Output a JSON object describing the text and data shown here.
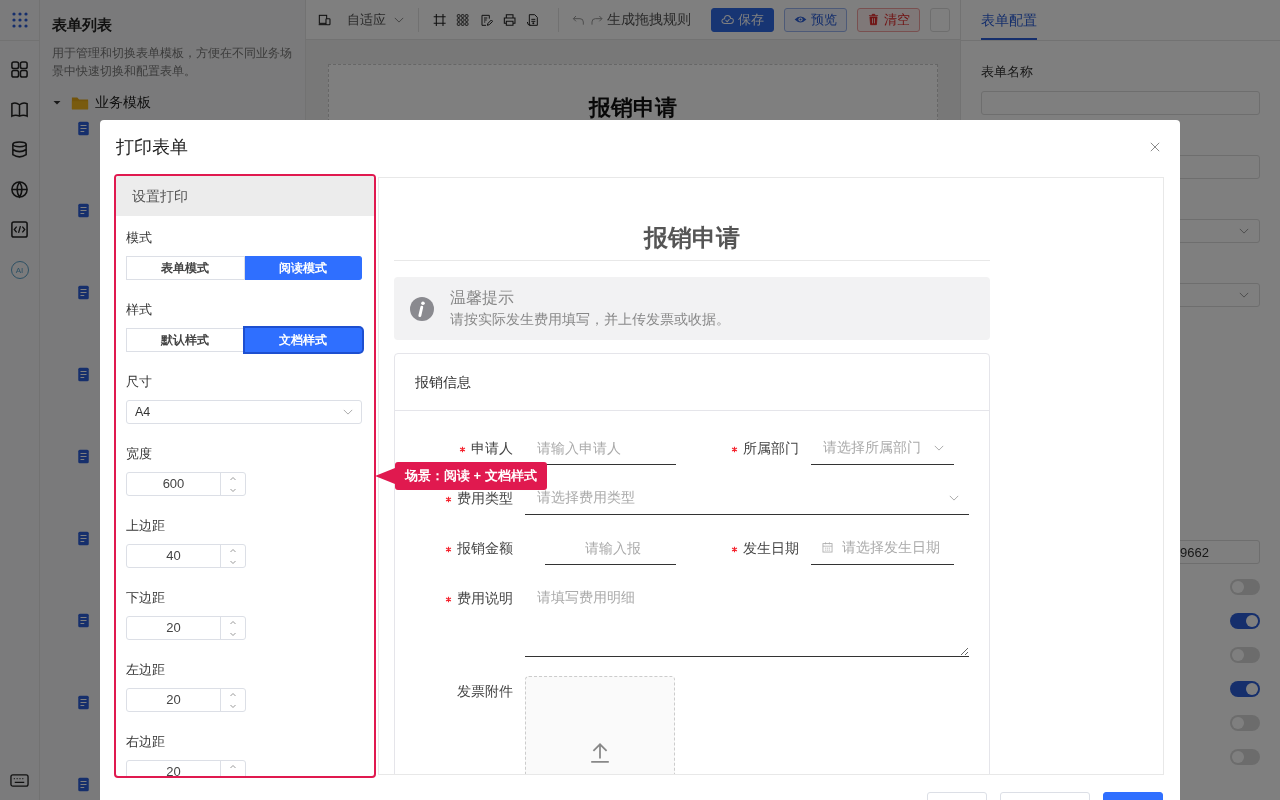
{
  "rail": {
    "items": [
      {
        "kind": "apps"
      },
      {
        "kind": "grid"
      },
      {
        "kind": "book"
      },
      {
        "kind": "database"
      },
      {
        "kind": "globe"
      },
      {
        "kind": "code"
      },
      {
        "kind": "ai",
        "label": "AI"
      }
    ],
    "bottom": {
      "kind": "keyboard"
    }
  },
  "sidebar": {
    "title": "表单列表",
    "description": "用于管理和切换表单模板，方便在不同业务场景中快速切换和配置表单。",
    "tree": [
      {
        "label": "业务模板",
        "expanded": true,
        "children": [
          {
            "kind": "doc"
          },
          {
            "kind": "doc"
          },
          {
            "kind": "doc"
          },
          {
            "kind": "doc"
          },
          {
            "kind": "doc"
          },
          {
            "kind": "doc"
          },
          {
            "kind": "doc"
          },
          {
            "kind": "doc"
          },
          {
            "kind": "doc"
          }
        ]
      }
    ]
  },
  "toolbar": {
    "device_select": "自适应",
    "tools": [
      {
        "kind": "device"
      },
      {
        "kind": "frame"
      },
      {
        "kind": "grid"
      },
      {
        "kind": "edit"
      },
      {
        "kind": "print"
      },
      {
        "kind": "scan"
      }
    ],
    "history": [
      {
        "kind": "undo"
      },
      {
        "kind": "redo"
      }
    ],
    "action": "生成拖拽规则",
    "buttons": [
      {
        "kind": "primary",
        "label": "保存"
      },
      {
        "kind": "outline",
        "label": "预览"
      },
      {
        "kind": "danger",
        "label": "清空"
      },
      {
        "kind": "plain"
      }
    ]
  },
  "canvas": {
    "title": "报销申请"
  },
  "right_panel": {
    "tabs": [
      {
        "label": "表单配置",
        "selected": true
      }
    ],
    "form_name_label": "表单名称",
    "fields": [
      {
        "kind": "input"
      },
      {
        "kind": "input"
      },
      {
        "kind": "select"
      },
      {
        "kind": "select"
      }
    ],
    "tail_input": {
      "value": "9662"
    },
    "switches": [
      {
        "on": false
      },
      {
        "on": true
      },
      {
        "on": false
      },
      {
        "on": true
      },
      {
        "on": false
      },
      {
        "on": false
      }
    ]
  },
  "dialog": {
    "title": "打印表单",
    "settings": {
      "header": "设置打印",
      "fields": [
        {
          "kind": "segmented",
          "label": "模式",
          "options": [
            {
              "label": "表单模式",
              "selected": false,
              "focused": false
            },
            {
              "label": "阅读模式",
              "selected": true,
              "focused": false
            }
          ]
        },
        {
          "kind": "segmented",
          "label": "样式",
          "options": [
            {
              "label": "默认样式",
              "selected": false,
              "focused": false
            },
            {
              "label": "文档样式",
              "selected": true,
              "focused": true
            }
          ]
        },
        {
          "kind": "select",
          "label": "尺寸",
          "value": "A4"
        },
        {
          "kind": "number",
          "label": "宽度",
          "value": "600"
        },
        {
          "kind": "number",
          "label": "上边距",
          "value": "40"
        },
        {
          "kind": "number",
          "label": "下边距",
          "value": "20"
        },
        {
          "kind": "number",
          "label": "左边距",
          "value": "20"
        },
        {
          "kind": "number",
          "label": "右边距",
          "value": "20"
        }
      ]
    },
    "callout": "场景：阅读 + 文档样式",
    "preview": {
      "title": "报销申请",
      "alert": {
        "title": "温馨提示",
        "text": "请按实际发生费用填写，并上传发票或收据。"
      },
      "section": {
        "title": "报销信息",
        "rows": [
          [
            {
              "kind": "input",
              "label": "申请人",
              "required": true,
              "placeholder": "请输入申请人"
            },
            {
              "kind": "select",
              "label": "所属部门",
              "required": true,
              "placeholder": "请选择所属部门"
            }
          ],
          [
            {
              "kind": "select",
              "label": "费用类型",
              "required": true,
              "placeholder": "请选择费用类型"
            }
          ],
          [
            {
              "kind": "number",
              "label": "报销金额",
              "required": true,
              "placeholder": "请输入报"
            },
            {
              "kind": "date",
              "label": "发生日期",
              "required": true,
              "placeholder": "请选择发生日期"
            }
          ],
          [
            {
              "kind": "textarea",
              "label": "费用说明",
              "required": true,
              "placeholder": "请填写费用明细"
            }
          ],
          [
            {
              "kind": "upload",
              "label": "发票附件",
              "required": false
            }
          ]
        ]
      }
    },
    "footer_buttons": [
      {
        "kind": "default"
      },
      {
        "kind": "default"
      },
      {
        "kind": "primary"
      }
    ]
  }
}
